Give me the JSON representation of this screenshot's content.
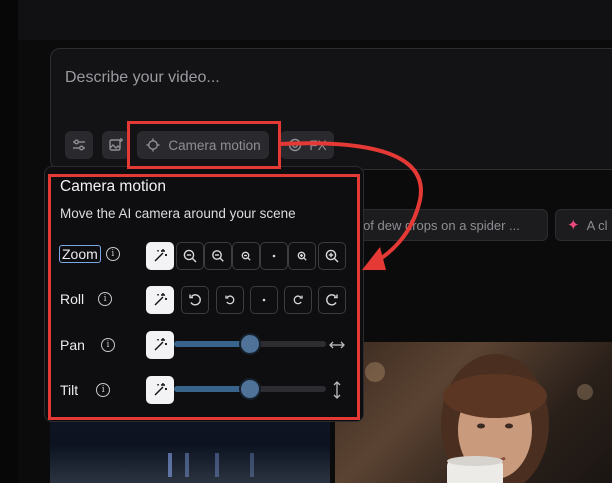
{
  "composer": {
    "placeholder": "Describe your video..."
  },
  "toolbar": {
    "camera_motion_label": "Camera motion",
    "fx_label": "FX"
  },
  "suggestions": [
    "up of dew drops on a spider ...",
    "A cl"
  ],
  "camera_panel": {
    "title": "Camera motion",
    "subtitle": "Move the AI camera around your scene",
    "rows": {
      "zoom": {
        "label": "Zoom",
        "info": "i"
      },
      "roll": {
        "label": "Roll",
        "info": "i"
      },
      "pan": {
        "label": "Pan",
        "info": "i",
        "value": 0.5
      },
      "tilt": {
        "label": "Tilt",
        "info": "i",
        "value": 0.5
      }
    }
  },
  "colors": {
    "annotation": "#e53935",
    "slider_fill": "#38638b",
    "accent_suggestion": "#e8497a"
  }
}
